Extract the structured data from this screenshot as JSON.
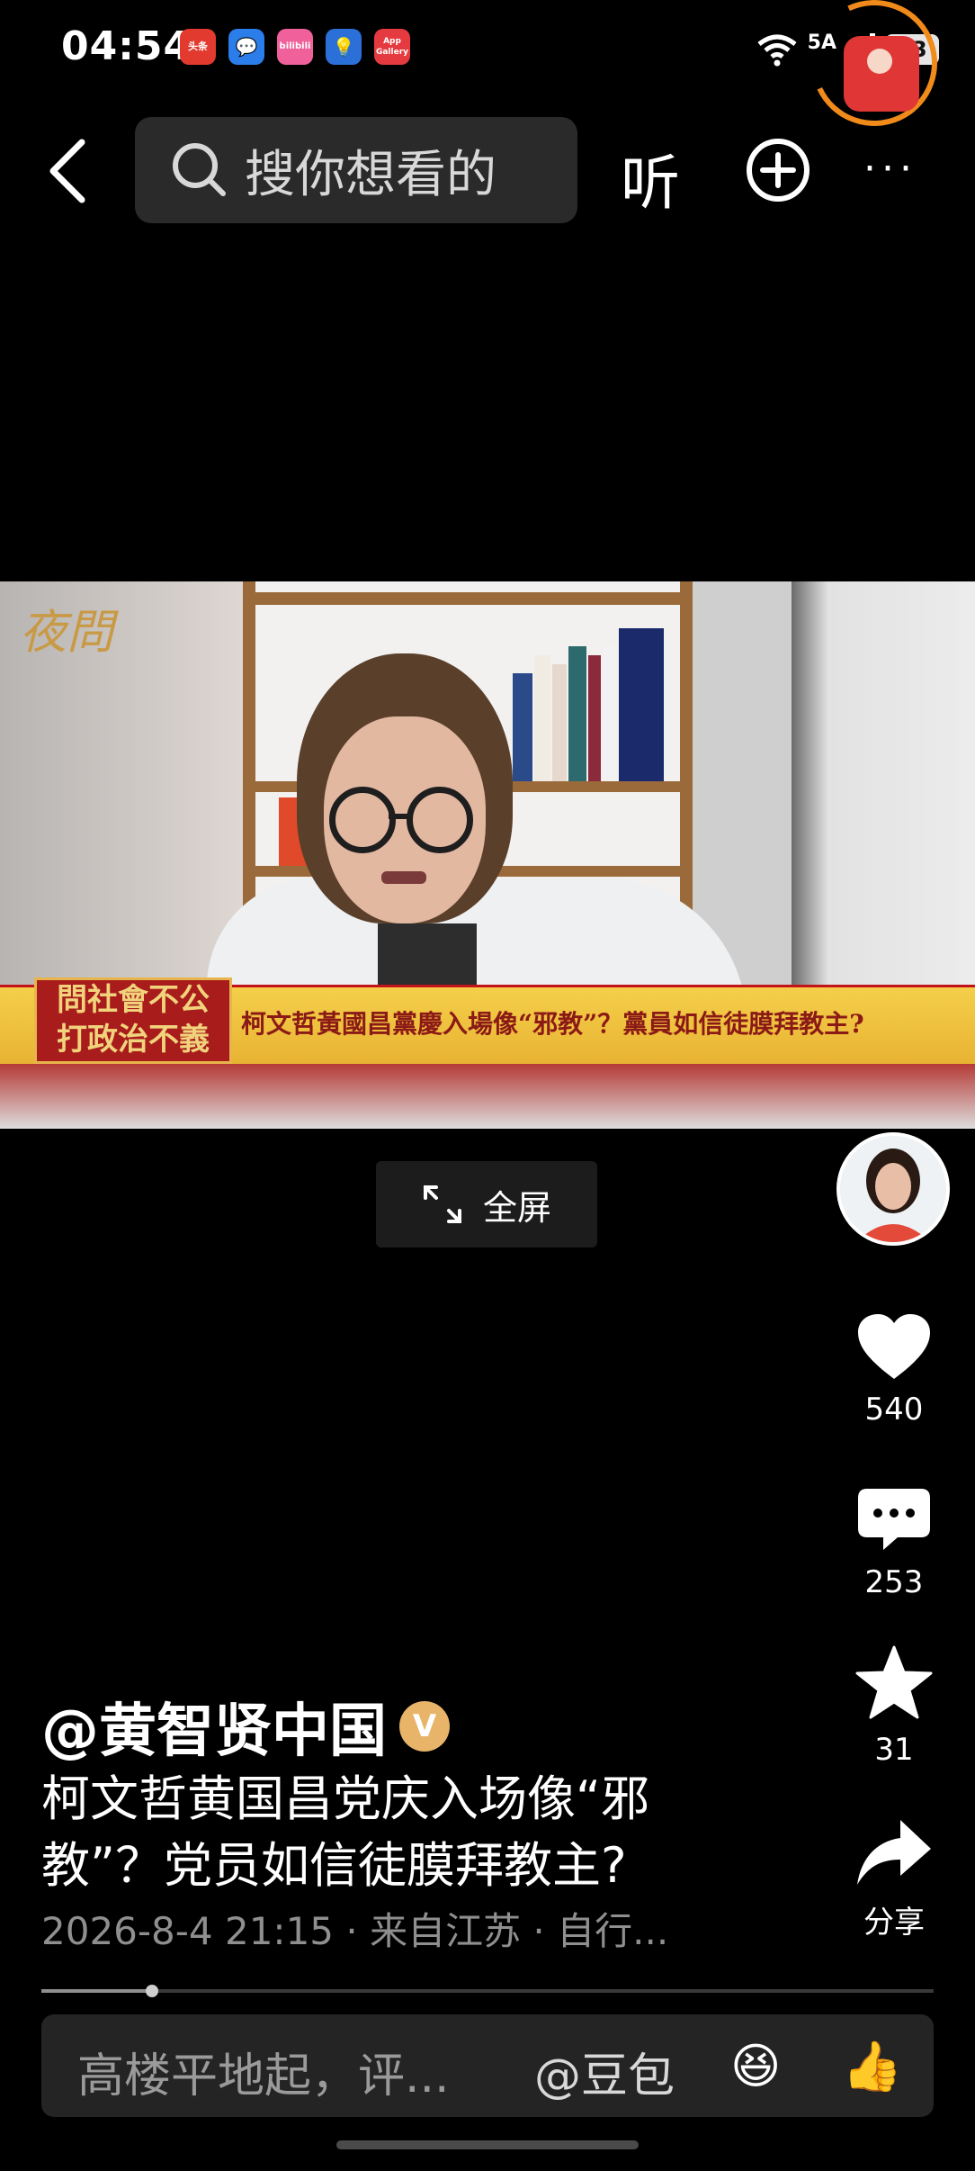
{
  "status_bar": {
    "time": "04:54",
    "apps": [
      "头条",
      "消息",
      "bilibili",
      "灯泡",
      "App Gallery"
    ],
    "network": "5A",
    "battery": "93"
  },
  "top_bar": {
    "search_placeholder": "搜你想看的",
    "listen_label": "听",
    "more_label": "···"
  },
  "video": {
    "program_logo": "夜問",
    "ticker_box_line1": "問社會不公",
    "ticker_box_line2": "打政治不義",
    "ticker_text": "柯文哲黃國昌黨慶入場像“邪教”？黨員如信徒膜拜教主?"
  },
  "fullscreen_label": "全屏",
  "rail": {
    "likes": "540",
    "comments": "253",
    "favorites": "31",
    "share_label": "分享"
  },
  "post": {
    "author": "@黄智贤中国",
    "verified_label": "V",
    "caption_line1": "柯文哲黄国昌党庆入场像“邪",
    "caption_line2": "教”？党员如信徒膜拜教主?",
    "meta": "2026-8-4 21:15 · 来自江苏 · 自行..."
  },
  "playback": {
    "progress": 0.124
  },
  "comment_bar": {
    "placeholder": "高楼平地起，评...",
    "mention_label": "@豆包",
    "emoji": "😆",
    "thumb": "👍"
  },
  "colors": {
    "accent_ring": "#f08a1a",
    "red_packet": "#e03636",
    "verified": "#e8b46a"
  }
}
